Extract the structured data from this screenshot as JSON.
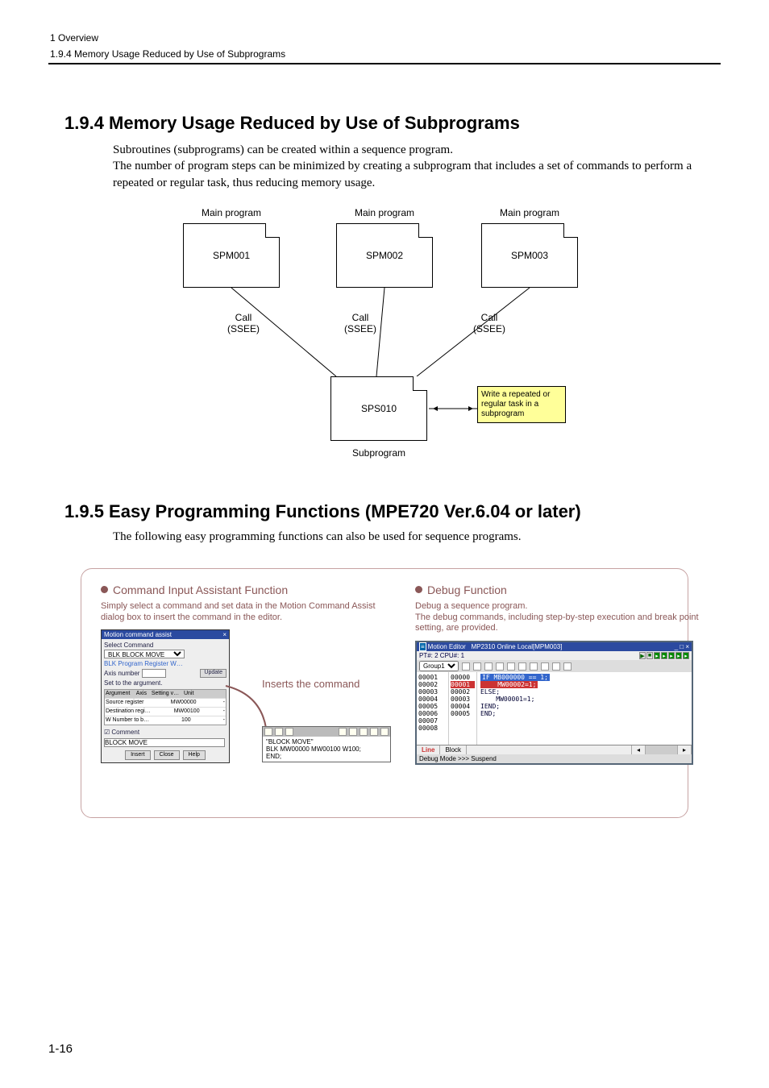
{
  "header": {
    "chapter": "1  Overview",
    "section": "1.9.4  Memory Usage Reduced by Use of Subprograms"
  },
  "sec194": {
    "heading": "1.9.4  Memory Usage Reduced by Use of Subprograms",
    "p1": "Subroutines (subprograms) can be created within a sequence program.",
    "p2": "The number of program steps can be minimized by creating a subprogram that includes a set of commands to perform a repeated or regular task, thus reducing memory usage.",
    "diagram": {
      "main_label": "Main program",
      "spm": [
        "SPM001",
        "SPM002",
        "SPM003"
      ],
      "call": "Call",
      "ssee": "(SSEE)",
      "sps": "SPS010",
      "sub_label": "Subprogram",
      "note": "Write a repeated or regular task in a subprogram"
    }
  },
  "sec195": {
    "heading": "1.9.5  Easy Programming Functions (MPE720 Ver.6.04 or later)",
    "p1": "The following easy programming functions can also be used for sequence programs.",
    "left": {
      "title": "Command Input Assistant Function",
      "desc": "Simply select a command and set data in the Motion Command Assist dialog box to insert the command in the editor.",
      "insert_label": "Inserts the command",
      "assist": {
        "window_title": "Motion command assist",
        "select_cmd_label": "Select Command",
        "select_cmd_value": "BLK  BLOCK MOVE",
        "format_label": "BLK Program Register W…",
        "axis_label": "Axis number",
        "update_btn": "Update",
        "args_label": "Set to the argument.",
        "table": {
          "headers": [
            "Argument",
            "Axis",
            "Setting v…",
            "Unit"
          ],
          "rows": [
            [
              "Source register",
              "- ",
              "MW00000",
              "-"
            ],
            [
              "Destination regi…",
              "- ",
              "MW00100",
              "-"
            ],
            [
              "W Number to b…",
              "- ",
              "100",
              "-"
            ]
          ]
        },
        "comment_chk": "Comment",
        "comment_val": "BLOCK MOVE",
        "buttons": [
          "Insert",
          "Close",
          "Help"
        ]
      },
      "editor_snip": {
        "lines": [
          "\"BLOCK MOVE\"",
          "BLK MW00000 MW00100 W100;",
          "END;"
        ]
      }
    },
    "right": {
      "title": "Debug Function",
      "desc": "Debug a sequence program.\nThe debug commands, including step-by-step execution and break point setting, are provided.",
      "editor": {
        "window_title_left": "Motion Editor",
        "window_title_right": "MP2310  Online Local[MPM003]",
        "pt_label": "PT#: 2 CPU#: 1",
        "group": "Group1",
        "line_numbers": [
          "00001",
          "00002",
          "00003",
          "00004",
          "00005",
          "00006",
          "00007",
          "00008"
        ],
        "bp_numbers": [
          "00000",
          "00001",
          "00002",
          "00003",
          "00004",
          "",
          "",
          "00005"
        ],
        "code": [
          "IF MB000000 == 1;",
          "    MW00002=1;",
          "ELSE;",
          "    MW00001=1;",
          "IEND;",
          "",
          "",
          "END;"
        ],
        "tabs": [
          "Line",
          "Block"
        ],
        "status": "Debug Mode  >>> Suspend"
      }
    }
  },
  "page_number": "1-16"
}
